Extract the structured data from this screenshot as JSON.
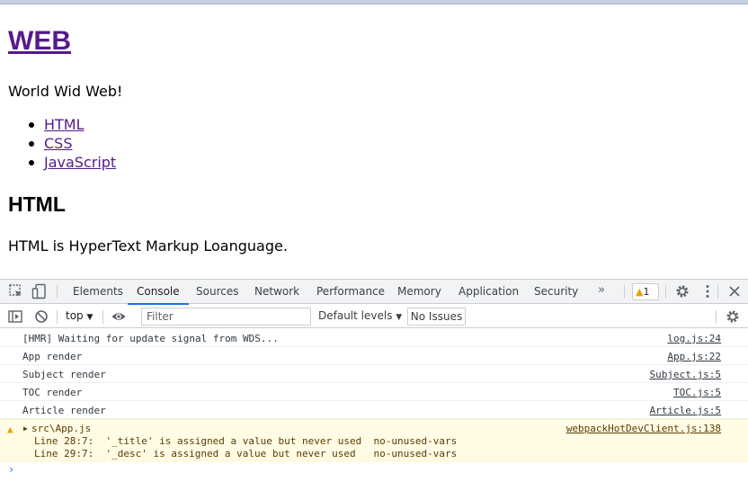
{
  "page": {
    "heading": "WEB",
    "intro": "World Wid Web!",
    "nav": [
      "HTML",
      "CSS",
      "JavaScript"
    ],
    "section_title": "HTML",
    "section_text": "HTML is HyperText Markup Loanguage."
  },
  "devtools": {
    "tabs": [
      "Elements",
      "Console",
      "Sources",
      "Network",
      "Performance",
      "Memory",
      "Application",
      "Security"
    ],
    "active_tab": "Console",
    "more_tabs": "»",
    "warning_count": "1",
    "context": "top",
    "filter_placeholder": "Filter",
    "levels": "Default levels",
    "issues": "No Issues",
    "messages": [
      {
        "text": "[HMR] Waiting for update signal from WDS...",
        "source": "log.js:24"
      },
      {
        "text": "App render",
        "source": "App.js:22"
      },
      {
        "text": "Subject render",
        "source": "Subject.js:5"
      },
      {
        "text": "TOC render",
        "source": "TOC.js:5"
      },
      {
        "text": "Article render",
        "source": "Article.js:5"
      }
    ],
    "warning": {
      "file": "src\\App.js",
      "source": "webpackHotDevClient.js:138",
      "line1": "Line 28:7:  '_title' is assigned a value but never used  no-unused-vars",
      "line2": "Line 29:7:  '_desc' is assigned a value but never used   no-unused-vars"
    },
    "prompt": "›"
  },
  "colors": {
    "link": "#551a8b",
    "active_tab_underline": "#1a73e8",
    "warning_bg": "#fffbe5",
    "warning_icon": "#e8a200"
  }
}
